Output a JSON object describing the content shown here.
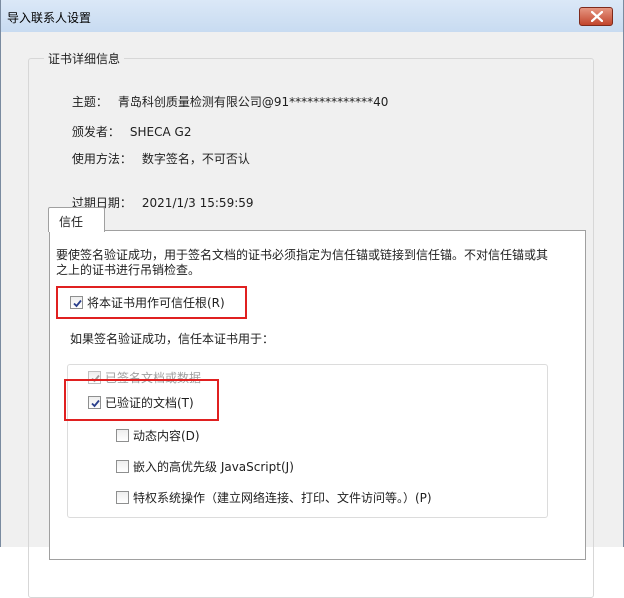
{
  "window": {
    "title": "导入联系人设置"
  },
  "details": {
    "group_title": "证书详细信息",
    "subject_label": "主题：",
    "subject_value": "青岛科创质量检测有限公司@91**************40",
    "issuer_label": "颁发者：",
    "issuer_value": "SHECA G2",
    "usage_label": "使用方法：",
    "usage_value": "数字签名，不可否认",
    "expiry_label": "过期日期：",
    "expiry_value": "2021/1/3 15:59:59"
  },
  "tabs": [
    {
      "label": "信任"
    }
  ],
  "trust": {
    "description": "要使签名验证成功，用于签名文档的证书必须指定为信任锚或链接到信任锚。不对信任锚或其之上的证书进行吊销检查。",
    "root_checkbox": {
      "label": "将本证书用作可信任根(R)",
      "checked": true
    },
    "intro": "如果签名验证成功，信任本证书用于：",
    "options": [
      {
        "label": "已签名文档或数据",
        "checked": true,
        "enabled": false
      },
      {
        "label": "已验证的文档(T)",
        "checked": true,
        "enabled": true
      },
      {
        "label": "动态内容(D)",
        "checked": false,
        "enabled": true
      },
      {
        "label": "嵌入的高优先级 JavaScript(J)",
        "checked": false,
        "enabled": true
      },
      {
        "label": "特权系统操作（建立网络连接、打印、文件访问等。）(P)",
        "checked": false,
        "enabled": true
      }
    ]
  },
  "colors": {
    "highlight_box": "#e02020"
  }
}
